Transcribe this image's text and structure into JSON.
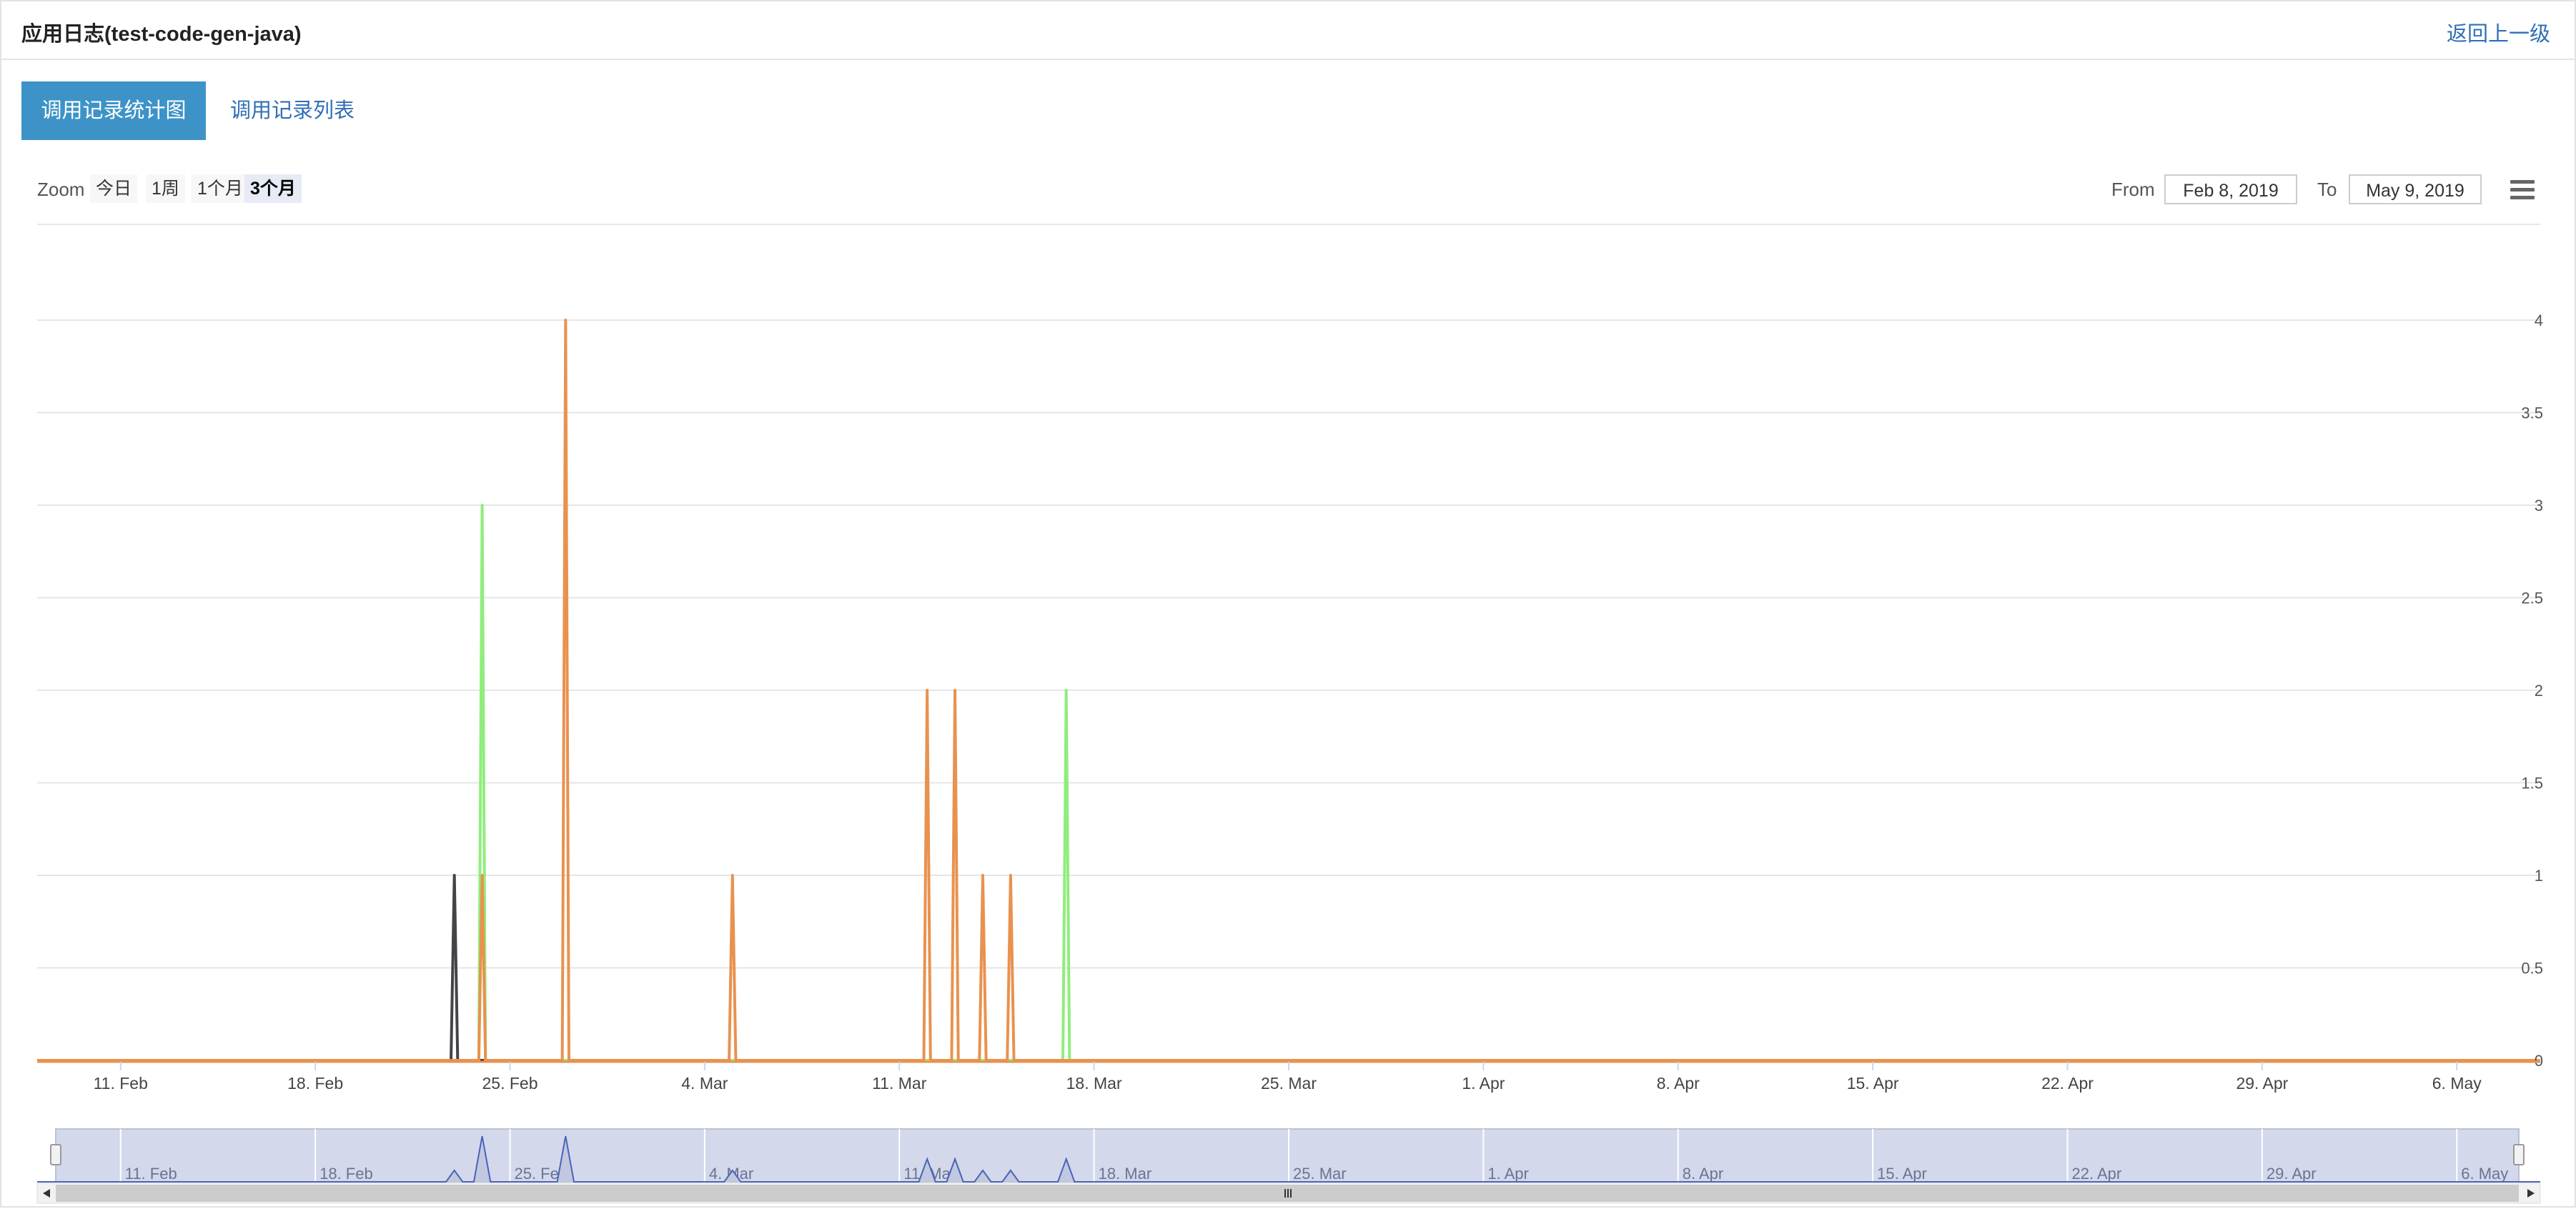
{
  "header": {
    "title": "应用日志(test-code-gen-java)",
    "back_label": "返回上一级"
  },
  "tabs": [
    {
      "label": "调用记录统计图"
    },
    {
      "label": "调用记录列表"
    }
  ],
  "toolbar": {
    "zoom_label": "Zoom",
    "zoom_options": [
      "今日",
      "1周",
      "1个月",
      "3个月"
    ],
    "selected_zoom": "3个月",
    "from_label": "From",
    "from_value": "Feb 8, 2019",
    "to_label": "To",
    "to_value": "May 9, 2019"
  },
  "icons": {
    "chart_menu": "hamburger-menu-icon"
  },
  "colors": {
    "series_orange": "#e8924f",
    "series_green": "#90ed7d",
    "series_black": "#434348",
    "navigator_fill": "#d3d9ea",
    "navigator_line": "#4a62bb",
    "tab_active": "#3d93c8"
  },
  "chart_data": {
    "type": "line",
    "x_range": [
      "2019-02-08",
      "2019-05-09"
    ],
    "x_ticks": [
      "11. Feb",
      "18. Feb",
      "25. Feb",
      "4. Mar",
      "11. Mar",
      "18. Mar",
      "25. Mar",
      "1. Apr",
      "8. Apr",
      "15. Apr",
      "22. Apr",
      "29. Apr",
      "6. May"
    ],
    "y_ticks": [
      "0",
      "0.5",
      "1",
      "1.5",
      "2",
      "2.5",
      "3",
      "3.5",
      "4"
    ],
    "ylim": [
      0,
      4
    ],
    "grid": true,
    "series": [
      {
        "color": "#434348",
        "points": [
          {
            "x": "2019-02-23",
            "y": 1
          }
        ]
      },
      {
        "color": "#90ed7d",
        "points": [
          {
            "x": "2019-02-24",
            "y": 3
          },
          {
            "x": "2019-03-17",
            "y": 2
          }
        ]
      },
      {
        "color": "#e8924f",
        "points": [
          {
            "x": "2019-02-24",
            "y": 1
          },
          {
            "x": "2019-02-27",
            "y": 4
          },
          {
            "x": "2019-03-05",
            "y": 1
          },
          {
            "x": "2019-03-12",
            "y": 2
          },
          {
            "x": "2019-03-13",
            "y": 2
          },
          {
            "x": "2019-03-14",
            "y": 1
          },
          {
            "x": "2019-03-15",
            "y": 1
          }
        ]
      }
    ]
  }
}
